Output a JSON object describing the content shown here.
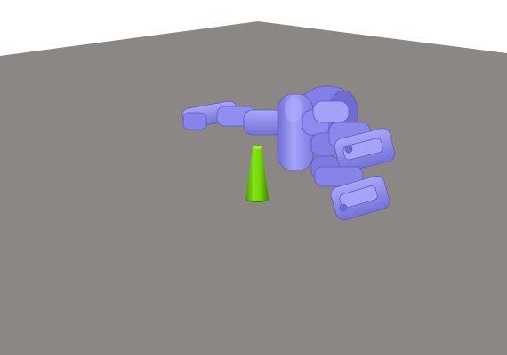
{
  "scene": {
    "background_color": "#ffffff",
    "floor_color": "#8b8785",
    "floor_edge_color": "#959190",
    "robot_hand_color": "#8b89ee",
    "robot_hand_shadow_color": "#6f6dcf",
    "robot_hand_highlight_color": "#b1afff",
    "target_object": "cone",
    "target_object_color": "#73d600",
    "target_object_shadow_color": "#4c9a00",
    "objects": [
      "floor-plane",
      "robot-hand",
      "green-cone"
    ]
  }
}
